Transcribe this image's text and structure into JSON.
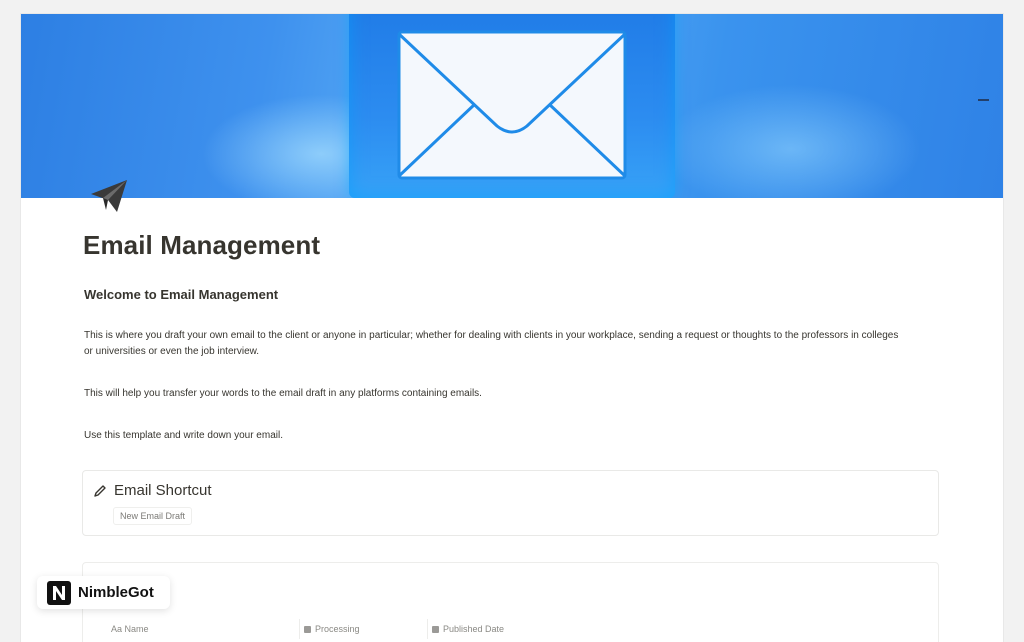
{
  "cover": {
    "colors": {
      "sky": "#3e91ee",
      "envelope": "#f4f8fd",
      "tile": "#1f7ae6"
    }
  },
  "page": {
    "icon": "paper-plane-icon",
    "title": "Email Management",
    "subheading": "Welcome to Email Management",
    "paragraphs": [
      "This is where you draft your own email to the client or anyone in particular; whether for dealing with clients in your workplace, sending a request or thoughts to the professors in colleges or universities or even the job interview.",
      "This will help you transfer your words to the email draft in any platforms containing emails.",
      "Use this template and write down your email."
    ]
  },
  "shortcut": {
    "icon": "pencil-icon",
    "title": "Email Shortcut",
    "button_label": "New Email Draft"
  },
  "database": {
    "columns": [
      {
        "label": "Aa Name"
      },
      {
        "label": "Processing"
      },
      {
        "label": "Published Date"
      }
    ]
  },
  "watermark": {
    "label": "NimbleGot",
    "logo_letter": "N"
  }
}
